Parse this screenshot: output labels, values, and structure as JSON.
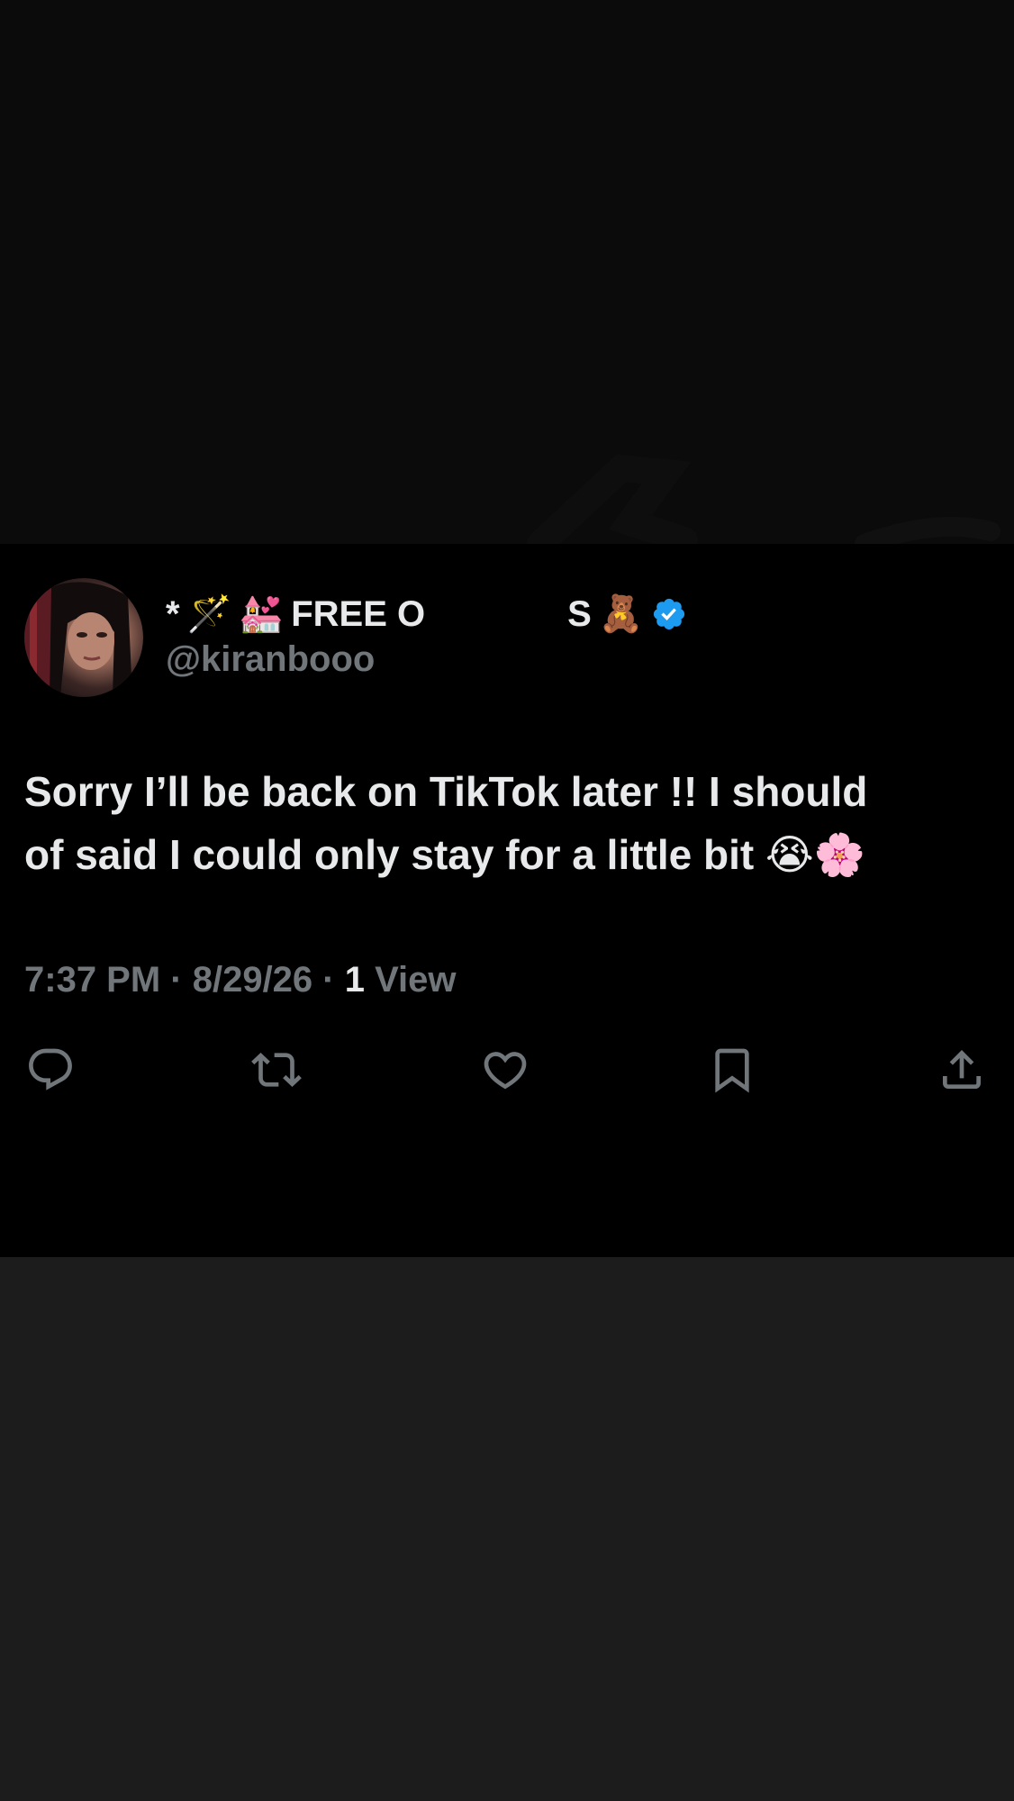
{
  "tweet": {
    "display_name": {
      "prefix": "*",
      "wand_emoji": "🪄",
      "chapel_emoji": "💒",
      "text": "FREE O",
      "suffix": "S",
      "bear_emoji": "🧸"
    },
    "handle": "@kiranbooo",
    "text_line1": "Sorry I’ll be back on TikTok later !! I should",
    "text_line2": "of said I could only stay for a little bit 😭🌸",
    "meta": {
      "time": "7:37 PM",
      "sep1": " · ",
      "date": "8/29/26",
      "sep2": " · ",
      "view_count": "1",
      "view_label": " View"
    }
  },
  "colors": {
    "accent_verified": "#1d9bf0",
    "text_primary": "#e7e9ea",
    "text_secondary": "#71767b",
    "card_bg": "#000000"
  },
  "actions": {
    "reply_icon": "reply-icon",
    "repost_icon": "repost-icon",
    "like_icon": "heart-icon",
    "bookmark_icon": "bookmark-icon",
    "share_icon": "share-icon"
  }
}
